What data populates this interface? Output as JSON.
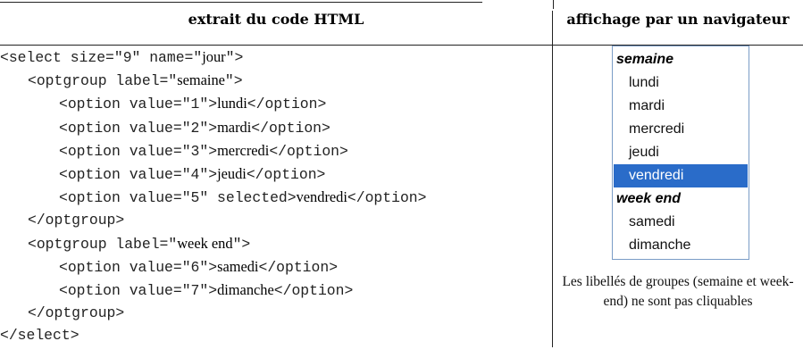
{
  "headers": {
    "left": "extrait du code HTML",
    "right": "affichage par un navigateur"
  },
  "code": {
    "select_open_tag": "<select size=\"9\" name=\"",
    "select_name": "jour",
    "select_open_end": "\">",
    "group1_open_tag": "<optgroup label=\"",
    "group1_label": "semaine",
    "group1_open_end": "\">",
    "group2_open_tag": "<optgroup label=\"",
    "group2_label": "week end",
    "group2_open_end": "\">",
    "optgroup_close": "</optgroup>",
    "select_close": "</select>",
    "option_close": "</option>",
    "options": [
      {
        "prefix": "<option value=\"1\">",
        "text": "lundi"
      },
      {
        "prefix": "<option value=\"2\">",
        "text": "mardi"
      },
      {
        "prefix": "<option value=\"3\">",
        "text": "mercredi"
      },
      {
        "prefix": "<option value=\"4\">",
        "text": "jeudi"
      },
      {
        "prefix": "<option value=\"5\" selected>",
        "text": "vendredi"
      },
      {
        "prefix": "<option value=\"6\">",
        "text": "samedi"
      },
      {
        "prefix": "<option value=\"7\">",
        "text": "dimanche"
      }
    ]
  },
  "render": {
    "group1": "semaine",
    "group2": "week end",
    "options": [
      "lundi",
      "mardi",
      "mercredi",
      "jeudi",
      "vendredi",
      "samedi",
      "dimanche"
    ],
    "note": "Les libellés de groupes (semaine et week-end) ne sont pas cliquables"
  },
  "colors": {
    "selection_bg": "#2a6cc9",
    "listbox_border": "#7a9cc6"
  }
}
